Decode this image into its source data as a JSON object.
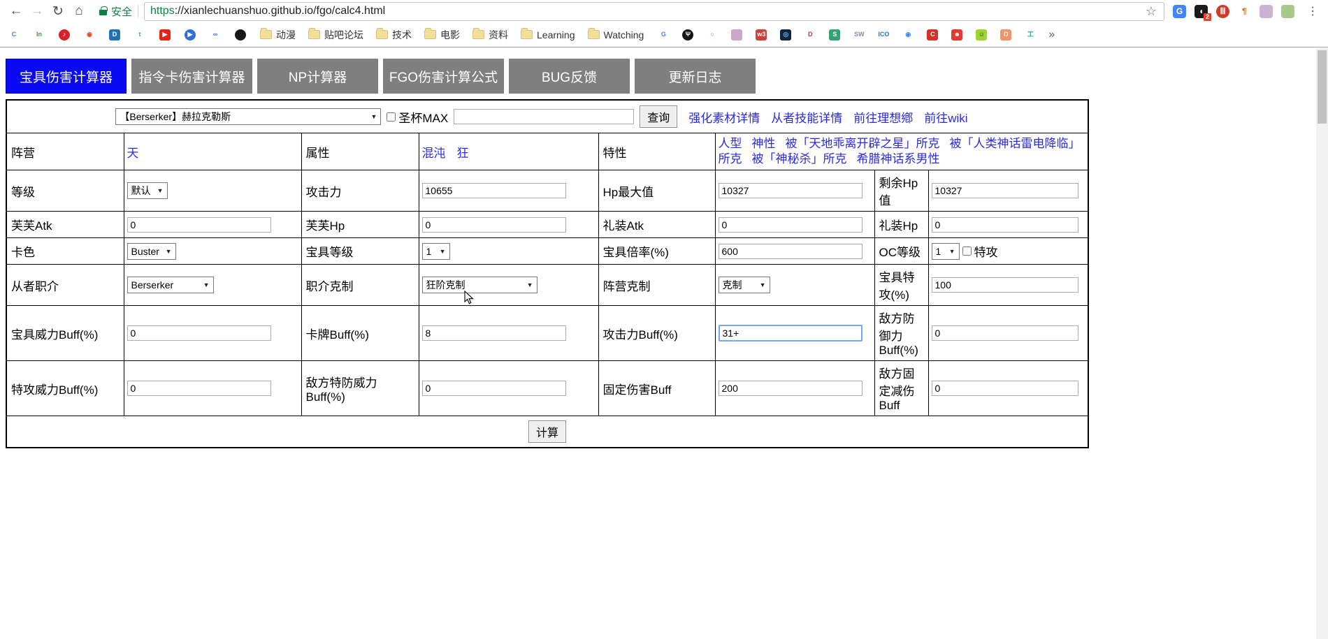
{
  "glyphs": {
    "back": "←",
    "forward": "→",
    "reload": "↻",
    "home": "⌂",
    "star": "☆",
    "menu_dots": "⋮",
    "select_arrow": "▼",
    "overflow": "»"
  },
  "browser": {
    "security_label": "安全",
    "url_scheme": "https",
    "url_rest": "://xianlechuanshuo.github.io/fgo/calc4.html",
    "extensions": [
      {
        "name": "translate-extension-icon",
        "glyph": "G",
        "bg": "#4285f4",
        "fg": "#ffffff"
      },
      {
        "name": "dark-extension-icon",
        "glyph": "◖",
        "bg": "#1b1b1b",
        "fg": "#ffffff",
        "badge": "2"
      },
      {
        "name": "adblock-extension-icon",
        "glyph": "Ⅲ",
        "bg": "#cf3a28",
        "fg": "#ffffff",
        "round": true
      },
      {
        "name": "pilcrow-extension-icon",
        "glyph": "¶",
        "fg": "#d2691e"
      },
      {
        "name": "avatar-extension-icon-1",
        "glyph": "",
        "bg": "#cbb3d6"
      },
      {
        "name": "avatar-extension-icon-2",
        "glyph": "",
        "bg": "#a9c98b"
      }
    ],
    "bookmarks_left": [
      {
        "name": "favicon-c-blue",
        "glyph": "C",
        "bg": "#ffffff",
        "fg": "#3f7fd0"
      },
      {
        "name": "favicon-info",
        "glyph": "In",
        "bg": "#ffffff",
        "fg": "#3a9e3f"
      },
      {
        "name": "favicon-netease-music",
        "glyph": "♪",
        "bg": "#d8222a",
        "fg": "#ffffff",
        "round": true
      },
      {
        "name": "favicon-weibo",
        "glyph": "◉",
        "bg": "#ffffff",
        "fg": "#e6452c"
      },
      {
        "name": "favicon-d-blue",
        "glyph": "D",
        "bg": "#2270b5",
        "fg": "#ffffff"
      },
      {
        "name": "favicon-twitter",
        "glyph": "t",
        "bg": "#ffffff",
        "fg": "#1da1f2"
      },
      {
        "name": "favicon-youtube",
        "glyph": "▶",
        "bg": "#e62117",
        "fg": "#ffffff"
      },
      {
        "name": "favicon-player-blue",
        "glyph": "▶",
        "bg": "#2f6fd6",
        "fg": "#ffffff",
        "round": true
      },
      {
        "name": "favicon-cloud-blue",
        "glyph": "∞",
        "bg": "#ffffff",
        "fg": "#2f6fd6"
      },
      {
        "name": "favicon-github",
        "glyph": "",
        "bg": "#191717",
        "fg": "#ffffff",
        "round": true
      }
    ],
    "bookmark_folders": [
      "动漫",
      "贴吧论坛",
      "技术",
      "电影",
      "资料",
      "Learning",
      "Watching"
    ],
    "bookmarks_right": [
      {
        "name": "favicon-google",
        "glyph": "G",
        "bg": "#ffffff",
        "fg": "#4285f4"
      },
      {
        "name": "favicon-fork-black",
        "glyph": "Ψ",
        "bg": "#151515",
        "fg": "#ffffff",
        "round": true
      },
      {
        "name": "favicon-cloud-orange",
        "glyph": "○",
        "bg": "#ffffff",
        "fg": "#f4623a"
      },
      {
        "name": "favicon-avatar-anime",
        "glyph": "",
        "bg": "#cfa5c8"
      },
      {
        "name": "favicon-w3school",
        "glyph": "w3",
        "bg": "#c9433a",
        "fg": "#ffffff"
      },
      {
        "name": "favicon-swirl-blue",
        "glyph": "◎",
        "bg": "#10243f",
        "fg": "#57b6e8"
      },
      {
        "name": "favicon-d-red",
        "glyph": "D",
        "bg": "#ffffff",
        "fg": "#cc2b2b"
      },
      {
        "name": "favicon-s-green",
        "glyph": "S",
        "bg": "#31a36f",
        "fg": "#ffffff"
      },
      {
        "name": "favicon-sw",
        "glyph": "SW",
        "bg": "#ffffff",
        "fg": "#9a7cc2"
      },
      {
        "name": "favicon-ico",
        "glyph": "ICO",
        "bg": "#ffffff",
        "fg": "#2f6fd6"
      },
      {
        "name": "favicon-chrome",
        "glyph": "◉",
        "bg": "#ffffff",
        "fg": "#4285f4"
      },
      {
        "name": "favicon-c-red",
        "glyph": "C",
        "bg": "#d93025",
        "fg": "#ffffff"
      },
      {
        "name": "favicon-skull-red",
        "glyph": "☻",
        "bg": "#e23b30",
        "fg": "#ffffff"
      },
      {
        "name": "favicon-tv-green",
        "glyph": "☺",
        "bg": "#9ed531",
        "fg": "#333333"
      },
      {
        "name": "favicon-d-orange",
        "glyph": "D",
        "bg": "#f0956a",
        "fg": "#ffffff"
      },
      {
        "name": "favicon-gong-teal",
        "glyph": "工",
        "bg": "#ffffff",
        "fg": "#18a5a0"
      }
    ]
  },
  "nav_tabs": [
    {
      "label": "宝具伤害计算器",
      "active": true
    },
    {
      "label": "指令卡伤害计算器",
      "active": false
    },
    {
      "label": "NP计算器",
      "active": false
    },
    {
      "label": "FGO伤害计算公式",
      "active": false
    },
    {
      "label": "BUG反馈",
      "active": false
    },
    {
      "label": "更新日志",
      "active": false
    }
  ],
  "toolbar": {
    "servant_select_value": "【Berserker】赫拉克勒斯",
    "grail_max_label": "圣杯MAX",
    "search_value": "",
    "query_button": "查询",
    "links": [
      "强化素材详情",
      "从者技能详情",
      "前往理想鄕",
      "前往wiki"
    ]
  },
  "grid": {
    "camp": {
      "label": "阵营",
      "value": "天"
    },
    "attribute": {
      "label": "属性",
      "values": [
        "混沌",
        "狂"
      ]
    },
    "trait": {
      "label": "特性",
      "values": [
        "人型",
        "神性",
        "被「天地乖离开辟之星」所克",
        "被「人类神话雷电降临」所克",
        "被「神秘杀」所克",
        "希腊神话系男性"
      ]
    },
    "level": {
      "label": "等级",
      "value": "默认"
    },
    "atk": {
      "label": "攻击力",
      "value": "10655"
    },
    "hp_max": {
      "label": "Hp最大值",
      "value": "10327"
    },
    "hp_left": {
      "label": "剩余Hp值",
      "value": "10327"
    },
    "fou_atk": {
      "label": "芙芙Atk",
      "value": "0"
    },
    "fou_hp": {
      "label": "芙芙Hp",
      "value": "0"
    },
    "ce_atk": {
      "label": "礼装Atk",
      "value": "0"
    },
    "ce_hp": {
      "label": "礼装Hp",
      "value": "0"
    },
    "card": {
      "label": "卡色",
      "value": "Buster"
    },
    "np_level": {
      "label": "宝具等级",
      "value": "1"
    },
    "np_rate": {
      "label": "宝具倍率(%)",
      "value": "600"
    },
    "oc": {
      "label": "OC等级",
      "value": "1",
      "checkbox_label": "特攻"
    },
    "servant_class": {
      "label": "从者职介",
      "value": "Berserker"
    },
    "class_adv": {
      "label": "职介克制",
      "value": "狂阶克制"
    },
    "camp_adv": {
      "label": "阵营克制",
      "value": "克制"
    },
    "np_sp": {
      "label": "宝具特攻(%)",
      "value": "100"
    },
    "np_buff": {
      "label": "宝具威力Buff(%)",
      "value": "0"
    },
    "card_buff": {
      "label": "卡牌Buff(%)",
      "value": "8"
    },
    "atk_buff": {
      "label": "攻击力Buff(%)",
      "value": "31+"
    },
    "def_buff": {
      "label": "敌方防御力Buff(%)",
      "value": "0"
    },
    "sp_buff": {
      "label": "特攻威力Buff(%)",
      "value": "0"
    },
    "enemy_sp_def_buff": {
      "label": "敌方特防威力Buff(%)",
      "value": "0"
    },
    "flat_dmg_buff": {
      "label": "固定伤害Buff",
      "value": "200"
    },
    "enemy_flat_reduce": {
      "label": "敌方固定减伤Buff",
      "value": "0"
    },
    "calc_button": "计算"
  }
}
